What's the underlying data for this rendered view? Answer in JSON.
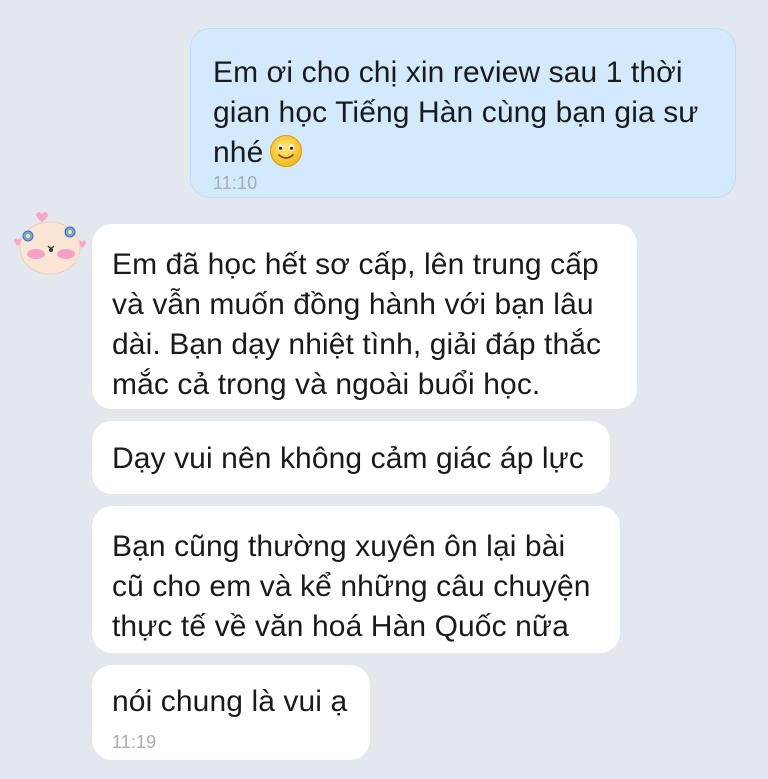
{
  "messages": {
    "out1": {
      "text": "Em ơi cho chị xin review sau 1 thời\ngian học Tiếng Hàn cùng bạn gia sư\nnhé",
      "emoji": "smiling-face-emoji",
      "time": "11:10"
    },
    "in1": {
      "text": "Em đã học hết sơ cấp, lên trung cấp\nvà vẫn muốn đồng hành với bạn lâu\ndài. Bạn dạy nhiệt tình, giải đáp thắc\nmắc cả trong và ngoài buổi học."
    },
    "in2": {
      "text": "Dạy vui nên không cảm giác áp lực"
    },
    "in3": {
      "text": "Bạn cũng thường xuyên ôn lại bài\ncũ cho em và kể những câu chuyện\nthực tế về văn hoá Hàn Quốc nữa"
    },
    "in4": {
      "text": "nói chung là vui ạ",
      "time": "11:19"
    }
  },
  "avatar": {
    "icon": "sticker-avatar-icon"
  },
  "colors": {
    "background": "#e3e8ee",
    "outgoing_bubble": "#d3eafd",
    "incoming_bubble": "#ffffff",
    "timestamp": "#a3acb7"
  }
}
